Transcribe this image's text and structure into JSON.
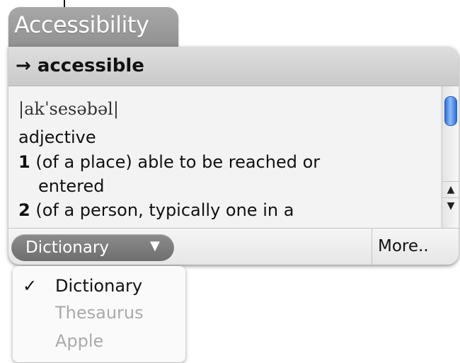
{
  "title": "Accessibility",
  "headword": "→ accessible",
  "entry": {
    "pronunciation": "|akˈsesəbəl|",
    "part_of_speech": "adjective",
    "senses": [
      {
        "num": "1",
        "text": "(of a place) able to be reached or",
        "continuation": "entered"
      },
      {
        "num": "2",
        "text": "(of a person, typically one in a"
      }
    ]
  },
  "scrollbar": {
    "up": "▲",
    "down": "▼"
  },
  "bottom": {
    "source_selected": "Dictionary",
    "more_label": "More.."
  },
  "menu": {
    "check": "✓",
    "items": [
      "Dictionary",
      "Thesaurus",
      "Apple"
    ]
  },
  "colors": {
    "scroll_thumb": "#2d6fd8",
    "menu_disabled": "#aaaaaa"
  }
}
